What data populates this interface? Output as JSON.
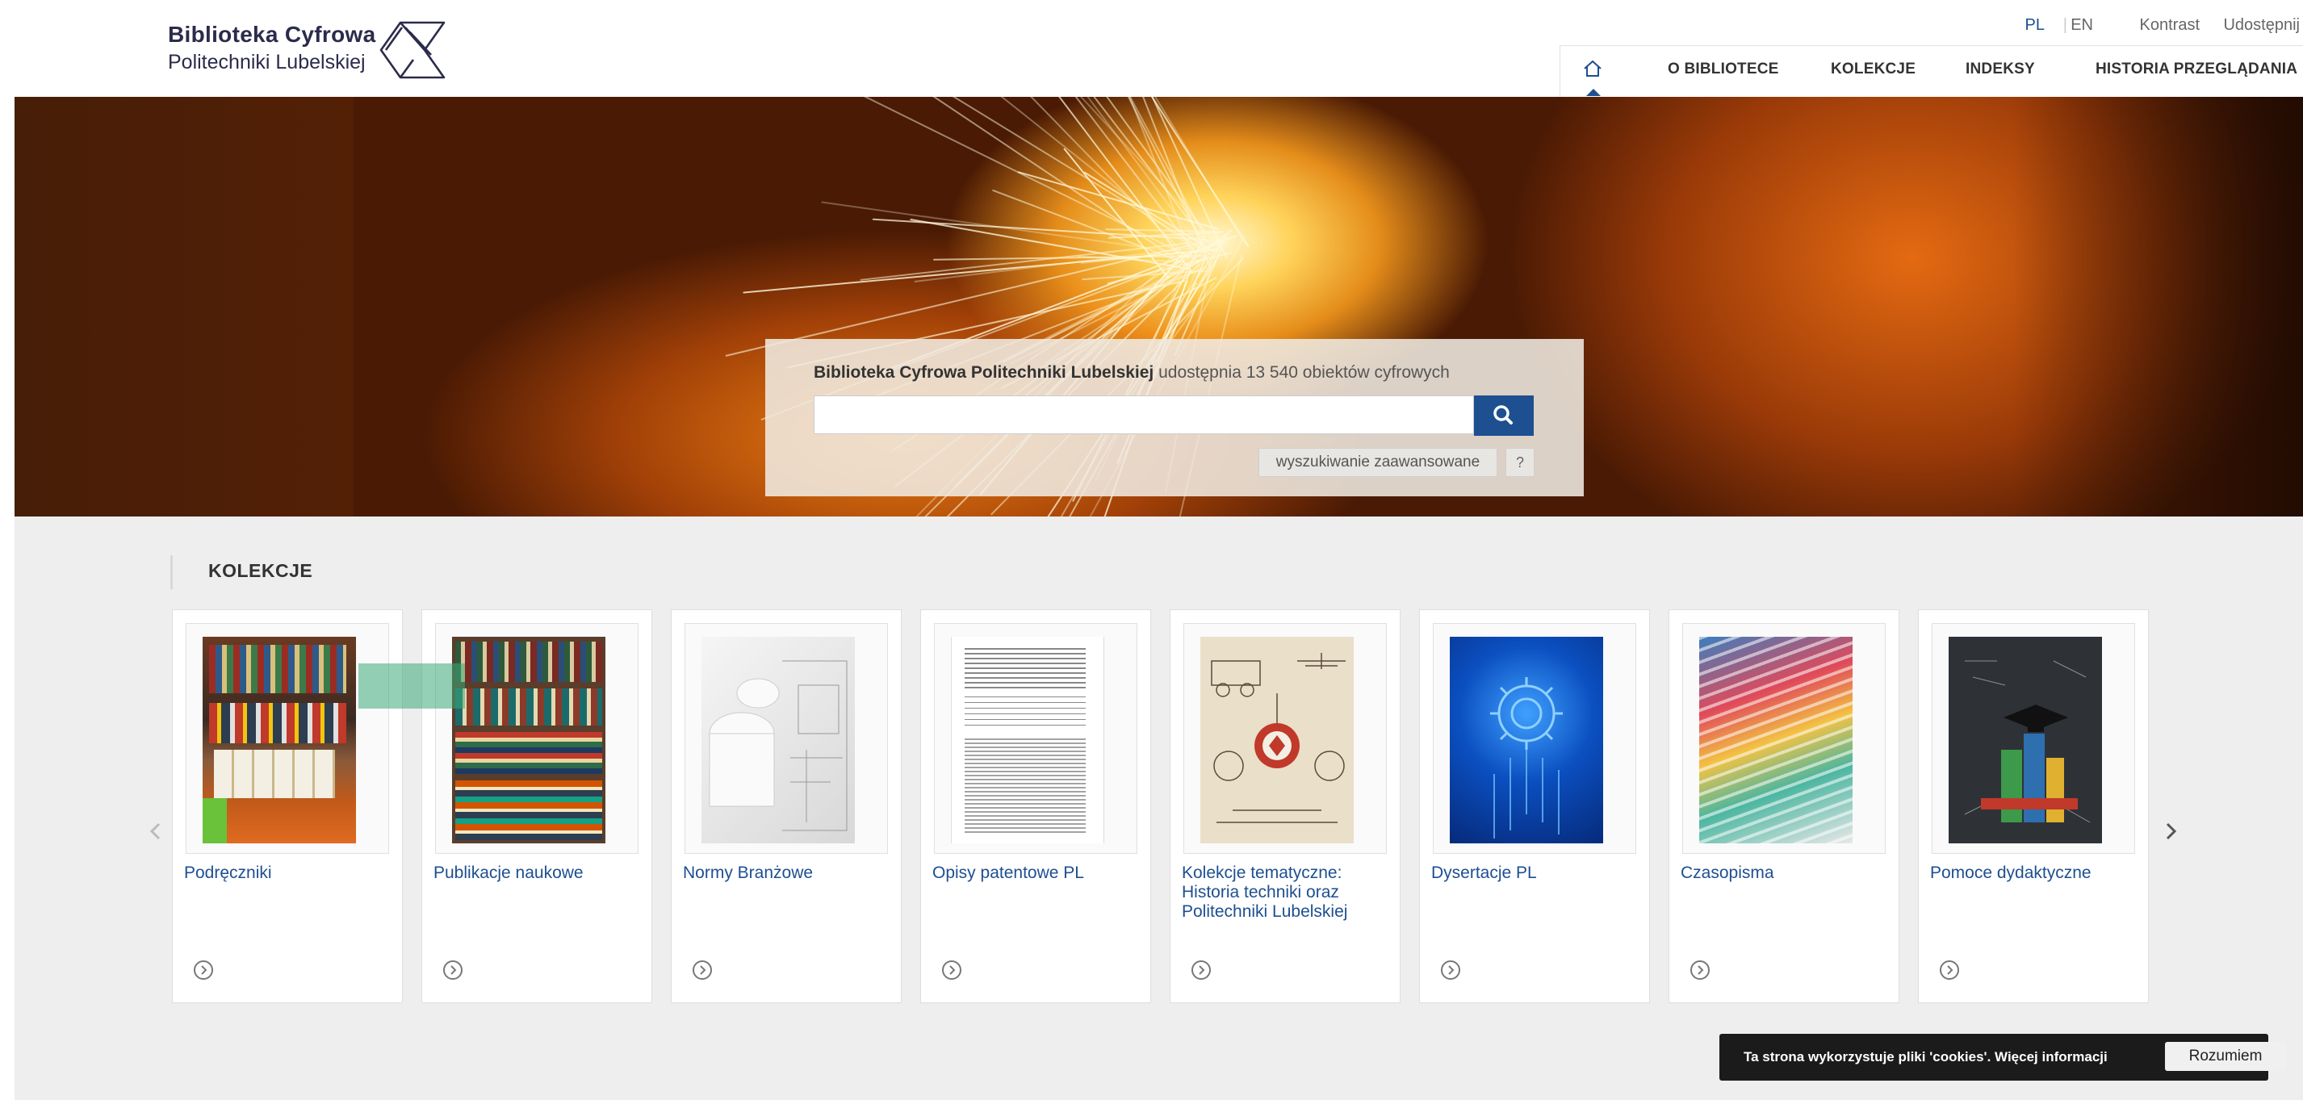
{
  "header": {
    "logo_line1": "Biblioteka Cyfrowa",
    "logo_line2": "Politechniki Lubelskiej",
    "util": {
      "lang_pl": "PL",
      "lang_sep": "|",
      "lang_en": "EN",
      "contrast": "Kontrast",
      "share": "Udostępnij"
    },
    "nav": [
      {
        "label": "O BIBLIOTECE"
      },
      {
        "label": "KOLEKCJE"
      },
      {
        "label": "INDEKSY"
      },
      {
        "label": "HISTORIA PRZEGLĄDANIA"
      }
    ]
  },
  "hero": {
    "heading_bold": "Biblioteka Cyfrowa Politechniki Lubelskiej",
    "heading_rest": " udostępnia 13 540 obiektów cyfrowych",
    "search_value": "",
    "advanced_label": "wyszukiwanie zaawansowane",
    "help_label": "?"
  },
  "collections": {
    "title": "KOLEKCJE",
    "items": [
      {
        "title": "Podręczniki",
        "thumb": "bookshelf-photo"
      },
      {
        "title": "Publikacje naukowe",
        "thumb": "bookshelf-stack-photo"
      },
      {
        "title": "Normy Branżowe",
        "thumb": "blueprint-rolls"
      },
      {
        "title": "Opisy patentowe PL",
        "thumb": "patent-document"
      },
      {
        "title": "Kolekcje tematyczne: Historia techniki oraz Politechniki Lubelskiej",
        "thumb": "vintage-technology-collage"
      },
      {
        "title": "Dysertacje PL",
        "thumb": "blue-circuit-gear"
      },
      {
        "title": "Czasopisma",
        "thumb": "magazine-stack"
      },
      {
        "title": "Pomoce dydaktyczne",
        "thumb": "chalkboard-books"
      }
    ]
  },
  "cookie": {
    "text": "Ta strona wykorzystuje pliki 'cookies'. ",
    "link": "Więcej informacji",
    "button": "Rozumiem"
  },
  "colors": {
    "brand_blue": "#1d4f91",
    "logo_text": "#2b2b4b",
    "section_bg": "#eeeeee"
  }
}
